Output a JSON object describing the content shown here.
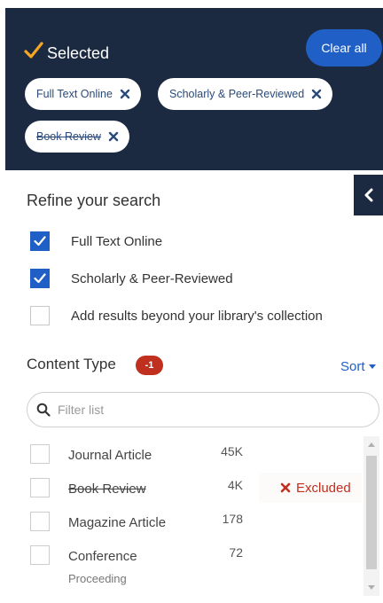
{
  "selected": {
    "title": "Selected",
    "clear_label": "Clear all",
    "accent": "#f5a623",
    "chips": [
      {
        "label": "Full Text Online",
        "excluded": false
      },
      {
        "label": "Scholarly & Peer-Reviewed",
        "excluded": false
      },
      {
        "label": "Book Review",
        "excluded": true
      }
    ]
  },
  "refine": {
    "heading": "Refine your search",
    "options": [
      {
        "label": "Full Text Online",
        "checked": true
      },
      {
        "label": "Scholarly & Peer-Reviewed",
        "checked": true
      },
      {
        "label": "Add results beyond your library's collection",
        "checked": false
      }
    ]
  },
  "content_type": {
    "heading": "Content Type",
    "badge": "-1",
    "sort_label": "Sort",
    "filter_placeholder": "Filter list",
    "items": [
      {
        "label": "Journal Article",
        "count": "45K",
        "excluded": false
      },
      {
        "label": "Book Review",
        "count": "4K",
        "excluded": true,
        "status": "Excluded"
      },
      {
        "label": "Magazine Article",
        "count": "178",
        "excluded": false
      },
      {
        "label": "Conference",
        "label_line2": "Proceeding",
        "count": "72",
        "excluded": false
      }
    ]
  },
  "colors": {
    "panel_bg": "#1b2a41",
    "primary": "#1f5fc6",
    "danger": "#c0301e"
  }
}
